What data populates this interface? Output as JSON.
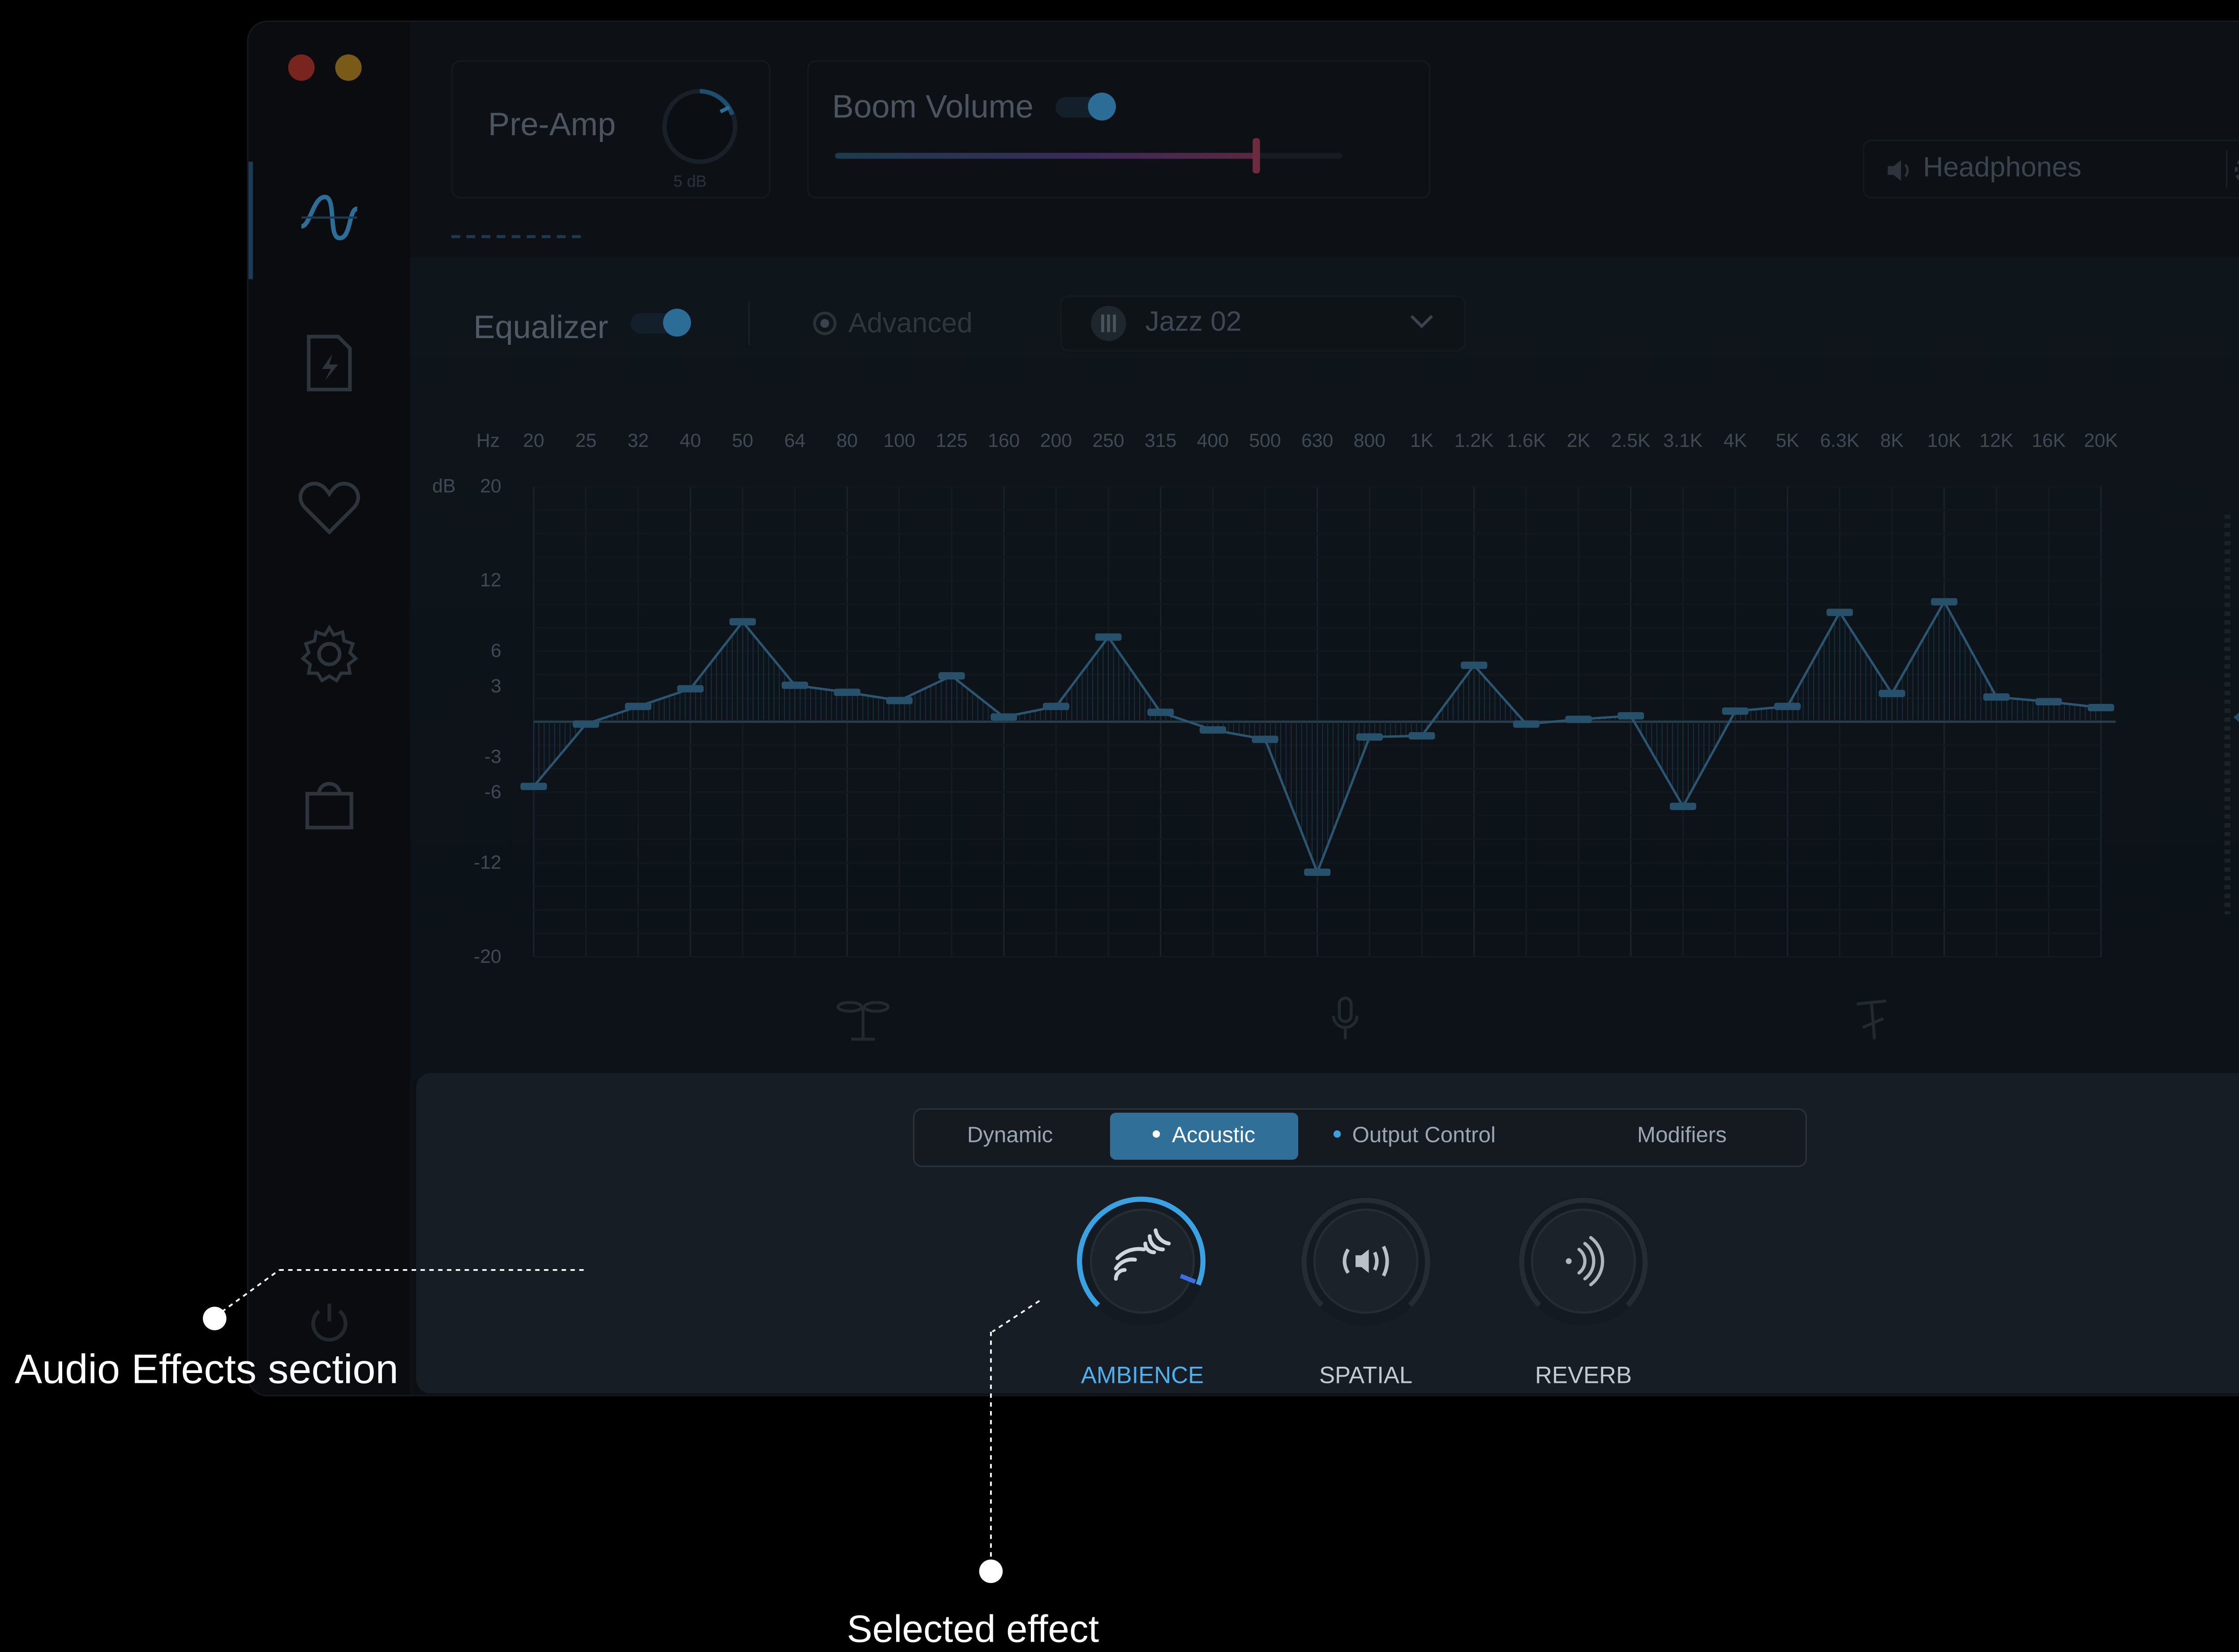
{
  "topbar": {
    "preamp_label": "Pre-Amp",
    "preamp_value": "5 dB",
    "boom_volume_label": "Boom Volume",
    "boom_volume_level": 0.83,
    "output_device": "Headphones"
  },
  "equalizer": {
    "label": "Equalizer",
    "advanced_label": "Advanced",
    "preset": "Jazz 02",
    "hz_label": "Hz",
    "db_label": "dB",
    "frequencies": [
      "20",
      "25",
      "32",
      "40",
      "50",
      "64",
      "80",
      "100",
      "125",
      "160",
      "200",
      "250",
      "315",
      "400",
      "500",
      "630",
      "800",
      "1K",
      "1.2K",
      "1.6K",
      "2K",
      "2.5K",
      "3.1K",
      "4K",
      "5K",
      "6.3K",
      "8K",
      "10K",
      "12K",
      "16K",
      "20K"
    ],
    "db_ticks": [
      "20",
      "12",
      "6",
      "3",
      "-3",
      "-6",
      "-12",
      "-20"
    ],
    "gains_db": [
      -5.5,
      -0.2,
      1.3,
      2.8,
      8.5,
      3.1,
      2.5,
      1.8,
      3.9,
      0.4,
      1.3,
      7.2,
      0.8,
      -0.7,
      -1.5,
      -12.8,
      -1.3,
      -1.2,
      4.8,
      -0.2,
      0.2,
      0.5,
      -7.2,
      0.9,
      1.3,
      9.3,
      2.4,
      10.2,
      2.1,
      1.7,
      1.2
    ]
  },
  "effects": {
    "tabs": [
      {
        "label": "Dynamic",
        "active": false,
        "dot": false
      },
      {
        "label": "Acoustic",
        "active": true,
        "dot": true
      },
      {
        "label": "Output Control",
        "active": false,
        "dot": true
      },
      {
        "label": "Modifiers",
        "active": false,
        "dot": false
      }
    ],
    "knobs": [
      {
        "label": "AMBIENCE",
        "selected": true,
        "icon": "ambience-icon"
      },
      {
        "label": "SPATIAL",
        "selected": false,
        "icon": "spatial-icon"
      },
      {
        "label": "REVERB",
        "selected": false,
        "icon": "reverb-icon"
      }
    ]
  },
  "callouts": {
    "audio_effects": "Audio Effects section",
    "selected_effect": "Selected effect"
  },
  "colors": {
    "accent": "#3aa2e0",
    "active_tab": "#2f6f98",
    "close": "#c0392b",
    "minimize": "#d4a12a"
  }
}
